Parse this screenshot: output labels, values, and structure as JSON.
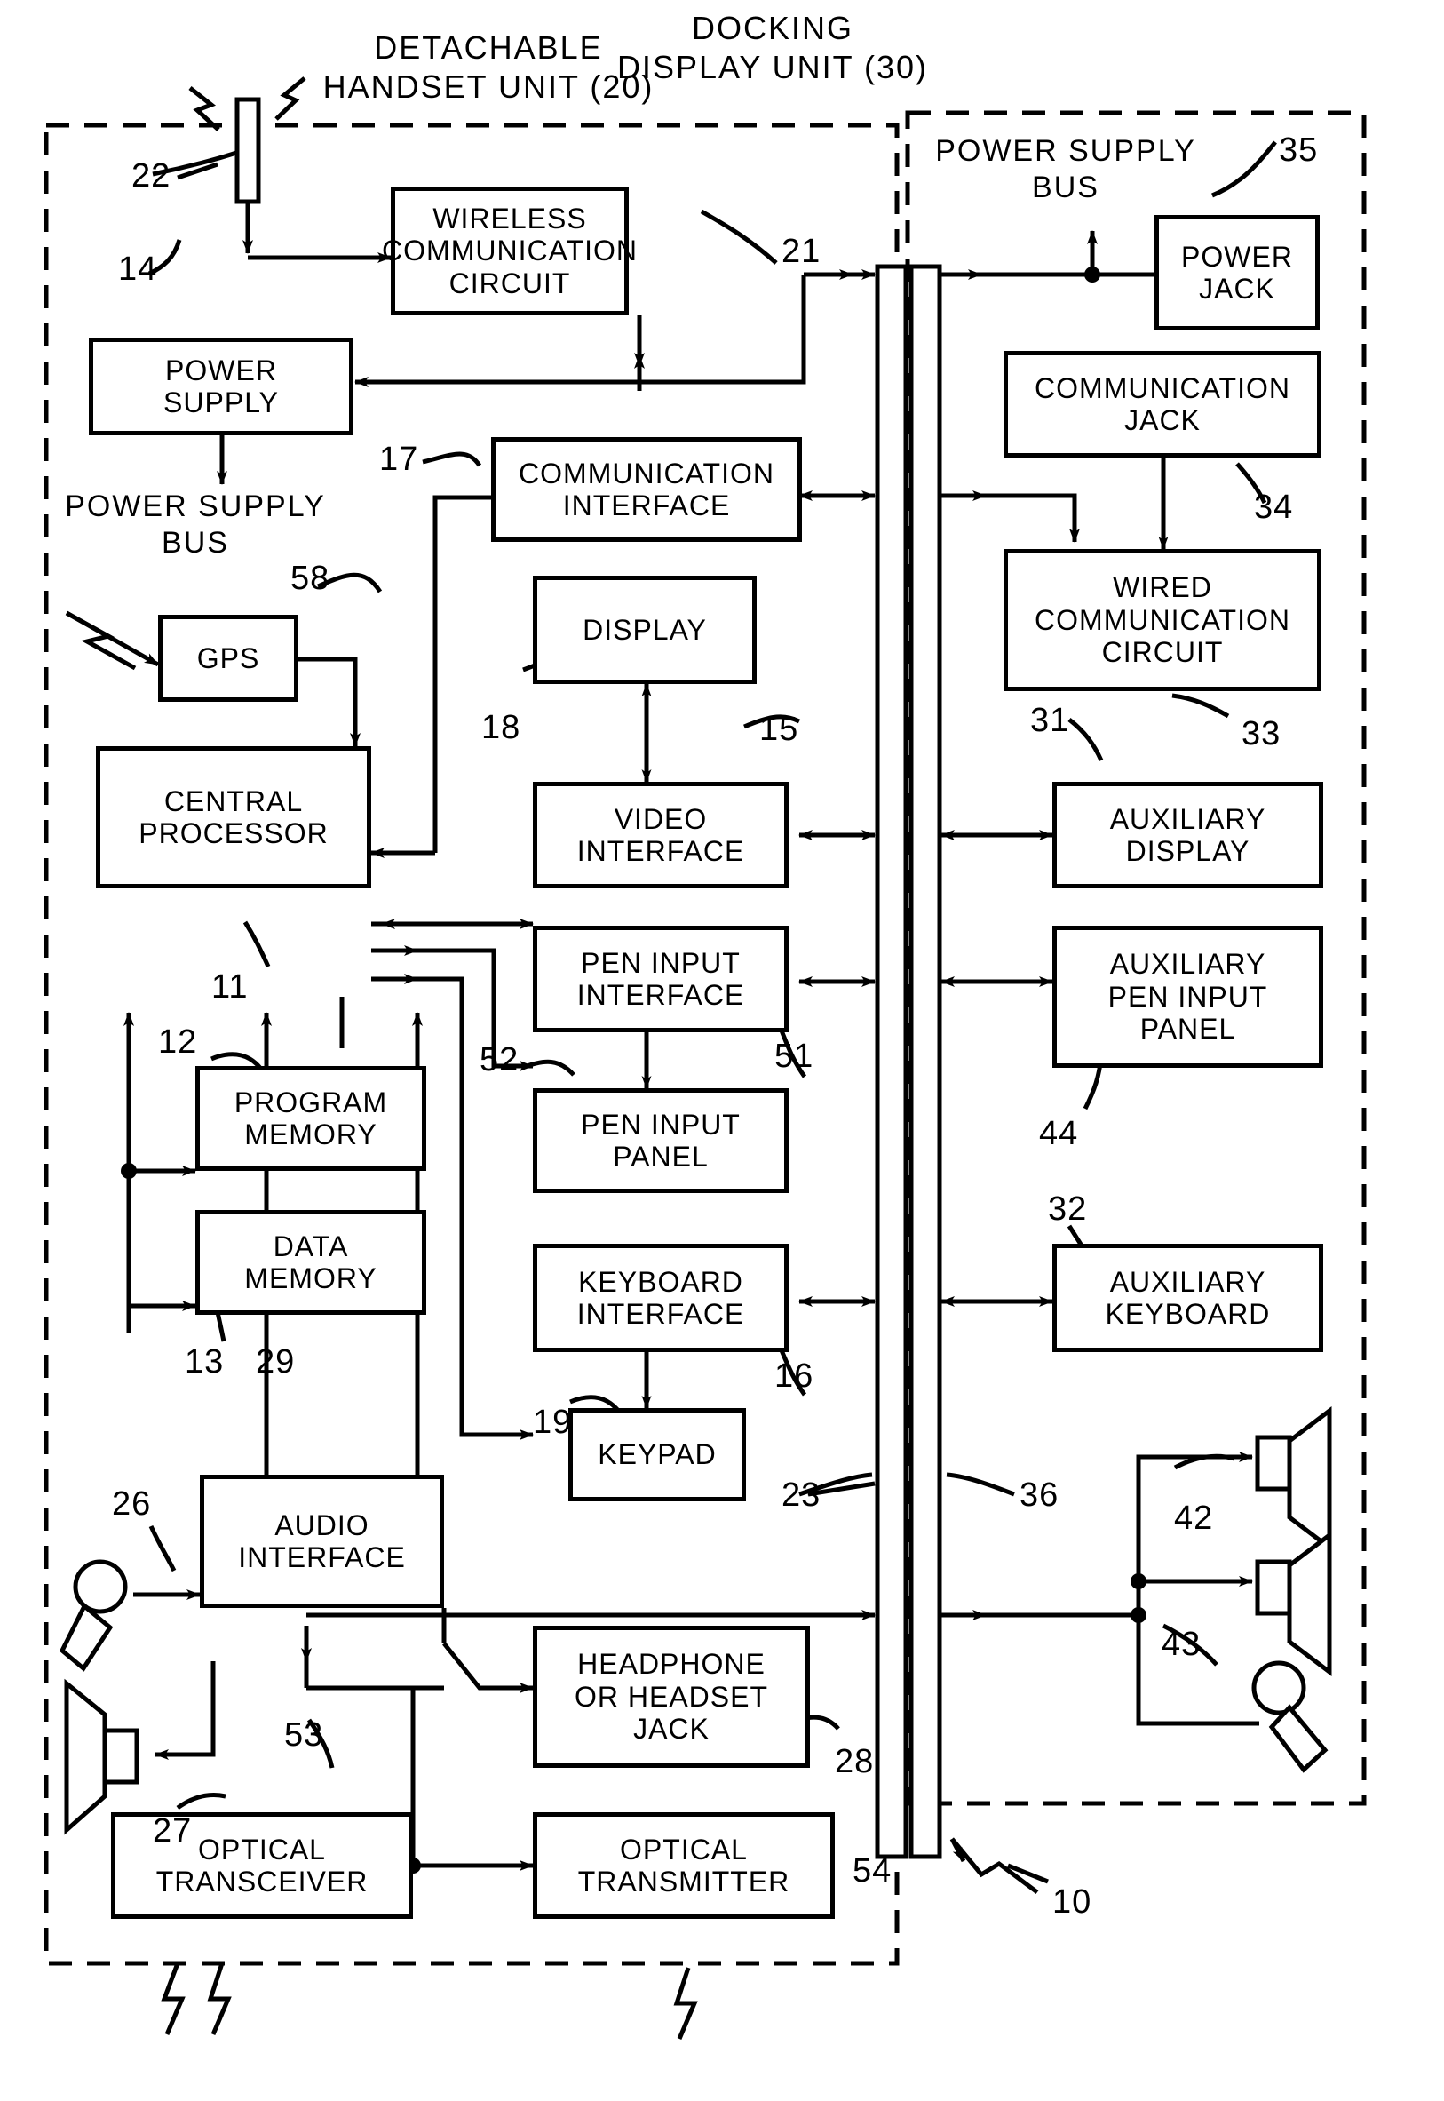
{
  "figure": {
    "caption_titles": [
      {
        "id": "detachable-handset-title",
        "text": "DETACHABLE\nHANDSET UNIT (20)"
      },
      {
        "id": "docking-display-title",
        "text": "DOCKING\nDISPLAY UNIT (30)"
      }
    ],
    "bus_labels": [
      {
        "id": "handset-power-supply-bus",
        "text": "POWER SUPPLY\nBUS"
      },
      {
        "id": "docking-power-supply-bus",
        "text": "POWER SUPPLY\nBUS"
      }
    ]
  },
  "handset_unit": {
    "blocks": [
      {
        "ref": "21",
        "name": "wireless-communication-circuit",
        "text": "WIRELESS\nCOMMUNICATION\nCIRCUIT"
      },
      {
        "ref": "14",
        "name": "power-supply",
        "text": "POWER\nSUPPLY"
      },
      {
        "ref": "17",
        "name": "communication-interface",
        "text": "COMMUNICATION\nINTERFACE"
      },
      {
        "ref": "18",
        "name": "display",
        "text": "DISPLAY"
      },
      {
        "ref": "58",
        "name": "gps",
        "text": "GPS"
      },
      {
        "ref": "11",
        "name": "central-processor",
        "text": "CENTRAL\nPROCESSOR"
      },
      {
        "ref": "15",
        "name": "video-interface",
        "text": "VIDEO\nINTERFACE"
      },
      {
        "ref": "51",
        "name": "pen-input-interface",
        "text": "PEN INPUT\nINTERFACE"
      },
      {
        "ref": "52",
        "name": "pen-input-panel",
        "text": "PEN INPUT\nPANEL"
      },
      {
        "ref": "12",
        "name": "program-memory",
        "text": "PROGRAM\nMEMORY"
      },
      {
        "ref": "13",
        "name": "data-memory",
        "text": "DATA\nMEMORY"
      },
      {
        "ref": "16",
        "name": "keyboard-interface",
        "text": "KEYBOARD\nINTERFACE"
      },
      {
        "ref": "19",
        "name": "keypad",
        "text": "KEYPAD"
      },
      {
        "ref": "29",
        "name": "audio-interface",
        "text": "AUDIO\nINTERFACE"
      },
      {
        "ref": "28",
        "name": "headphone-or-headset-jack",
        "text": "HEADPHONE\nOR HEADSET\nJACK"
      },
      {
        "ref": "53",
        "name": "optical-transceiver",
        "text": "OPTICAL\nTRANSCEIVER"
      },
      {
        "ref": "54",
        "name": "optical-transmitter",
        "text": "OPTICAL\nTRANSMITTER"
      }
    ],
    "components": [
      {
        "ref": "22",
        "name": "antenna"
      },
      {
        "ref": "26",
        "name": "microphone"
      },
      {
        "ref": "27",
        "name": "speaker"
      }
    ]
  },
  "docking_unit": {
    "blocks": [
      {
        "ref": "35",
        "name": "power-jack",
        "text": "POWER\nJACK"
      },
      {
        "ref": "34",
        "name": "communication-jack",
        "text": "COMMUNICATION\nJACK"
      },
      {
        "ref": "33",
        "name": "wired-communication-circuit",
        "text": "WIRED\nCOMMUNICATION\nCIRCUIT"
      },
      {
        "ref": "31",
        "name": "auxiliary-display",
        "text": "AUXILIARY\nDISPLAY"
      },
      {
        "ref": "44",
        "name": "auxiliary-pen-input-panel",
        "text": "AUXILIARY\nPEN INPUT\nPANEL"
      },
      {
        "ref": "32",
        "name": "auxiliary-keyboard",
        "text": "AUXILIARY\nKEYBOARD"
      }
    ],
    "components": [
      {
        "ref": "42",
        "name": "auxiliary-speakers"
      },
      {
        "ref": "43",
        "name": "auxiliary-microphone"
      }
    ]
  },
  "connectors": [
    {
      "ref": "23",
      "name": "handset-connector"
    },
    {
      "ref": "36",
      "name": "docking-connector"
    }
  ],
  "system": {
    "ref": "10",
    "name": "system-reference"
  },
  "reference_numerals": {
    "n10": "10",
    "n11": "11",
    "n12": "12",
    "n13": "13",
    "n14": "14",
    "n15": "15",
    "n16": "16",
    "n17": "17",
    "n18": "18",
    "n19": "19",
    "n21": "21",
    "n22": "22",
    "n23": "23",
    "n26": "26",
    "n27": "27",
    "n28": "28",
    "n29": "29",
    "n31": "31",
    "n32": "32",
    "n33": "33",
    "n34": "34",
    "n35": "35",
    "n36": "36",
    "n42": "42",
    "n43": "43",
    "n44": "44",
    "n51": "51",
    "n52": "52",
    "n53": "53",
    "n54": "54",
    "n58": "58"
  }
}
